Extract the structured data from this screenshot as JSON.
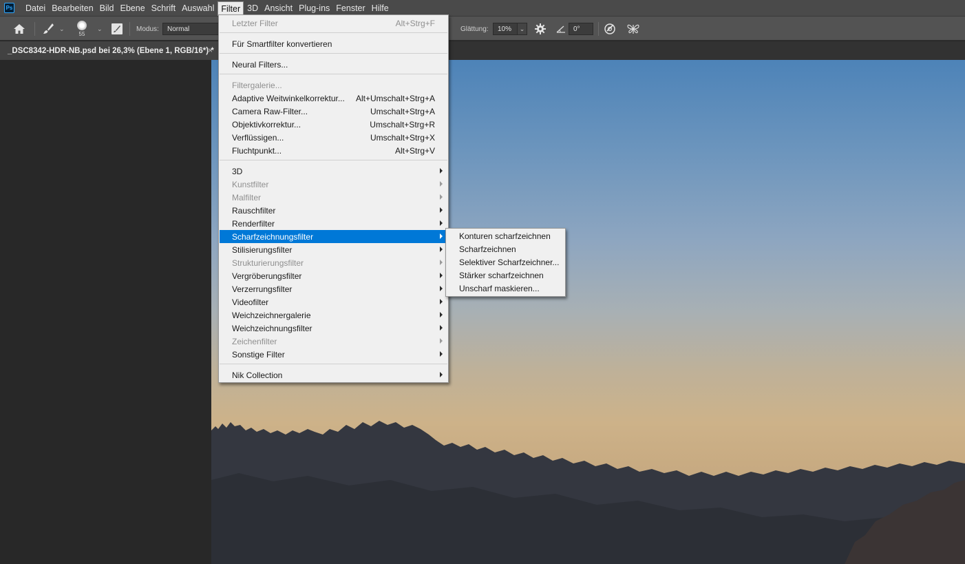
{
  "app": {
    "logo_text": "Ps",
    "accent": "#31a8ff"
  },
  "menubar": {
    "items": [
      "Datei",
      "Bearbeiten",
      "Bild",
      "Ebene",
      "Schrift",
      "Auswahl",
      "Filter",
      "3D",
      "Ansicht",
      "Plug-ins",
      "Fenster",
      "Hilfe"
    ],
    "active": "Filter"
  },
  "options": {
    "brush_size": "55",
    "mode_label": "Modus:",
    "mode_value": "Normal",
    "smoothing_label": "Glättung:",
    "smoothing_value": "10%",
    "angle_value": "0°",
    "icons": [
      "home-icon",
      "brush-icon",
      "brush-preset-icon",
      "brush-settings-toggle-icon",
      "settings-gear-icon",
      "angle-icon",
      "pressure-icon",
      "symmetry-icon"
    ]
  },
  "document": {
    "tab_title": "_DSC8342-HDR-NB.psd bei 26,3% (Ebene 1, RGB/16*) *",
    "close_glyph": "×"
  },
  "filter_menu": {
    "last_filter": {
      "label": "Letzter Filter",
      "shortcut": "Alt+Strg+F"
    },
    "smart": {
      "label": "Für Smartfilter konvertieren"
    },
    "neural": {
      "label": "Neural Filters..."
    },
    "gallery": {
      "label": "Filtergalerie..."
    },
    "adaptive": {
      "label": "Adaptive Weitwinkelkorrektur...",
      "shortcut": "Alt+Umschalt+Strg+A"
    },
    "camera_raw": {
      "label": "Camera Raw-Filter...",
      "shortcut": "Umschalt+Strg+A"
    },
    "lens": {
      "label": "Objektivkorrektur...",
      "shortcut": "Umschalt+Strg+R"
    },
    "liquify": {
      "label": "Verflüssigen...",
      "shortcut": "Umschalt+Strg+X"
    },
    "vanishing": {
      "label": "Fluchtpunkt...",
      "shortcut": "Alt+Strg+V"
    },
    "submenus": [
      {
        "label": "3D",
        "disabled": false
      },
      {
        "label": "Kunstfilter",
        "disabled": true
      },
      {
        "label": "Malfilter",
        "disabled": true
      },
      {
        "label": "Rauschfilter",
        "disabled": false
      },
      {
        "label": "Renderfilter",
        "disabled": false
      },
      {
        "label": "Scharfzeichnungsfilter",
        "disabled": false,
        "highlighted": true
      },
      {
        "label": "Stilisierungsfilter",
        "disabled": false
      },
      {
        "label": "Strukturierungsfilter",
        "disabled": true
      },
      {
        "label": "Vergröberungsfilter",
        "disabled": false
      },
      {
        "label": "Verzerrungsfilter",
        "disabled": false
      },
      {
        "label": "Videofilter",
        "disabled": false
      },
      {
        "label": "Weichzeichnergalerie",
        "disabled": false
      },
      {
        "label": "Weichzeichnungsfilter",
        "disabled": false
      },
      {
        "label": "Zeichenfilter",
        "disabled": true
      },
      {
        "label": "Sonstige Filter",
        "disabled": false
      }
    ],
    "nik": {
      "label": "Nik Collection"
    }
  },
  "sharpen_submenu": {
    "items": [
      "Konturen scharfzeichnen",
      "Scharfzeichnen",
      "Selektiver Scharfzeichner...",
      "Stärker scharfzeichnen",
      "Unscharf maskieren..."
    ]
  },
  "colors": {
    "highlight": "#0078d7",
    "menu_bg": "#f0f0f0",
    "menubar_bg": "#4a4a4a",
    "optionsbar_bg": "#535353",
    "workspace_bg": "#282828"
  }
}
